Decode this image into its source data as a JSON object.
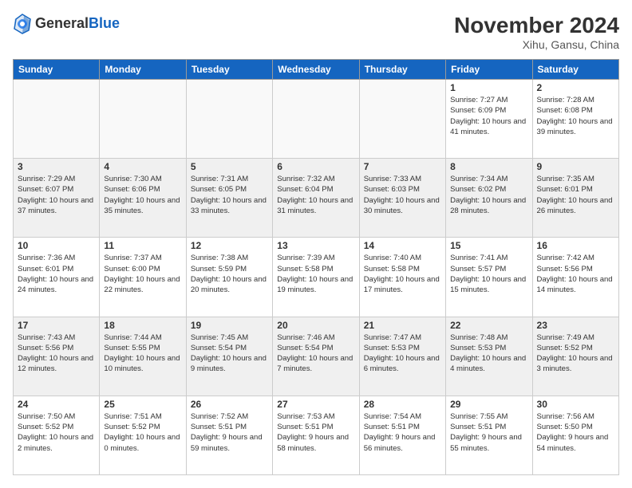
{
  "header": {
    "logo": {
      "general": "General",
      "blue": "Blue"
    },
    "title": "November 2024",
    "location": "Xihu, Gansu, China"
  },
  "days_of_week": [
    "Sunday",
    "Monday",
    "Tuesday",
    "Wednesday",
    "Thursday",
    "Friday",
    "Saturday"
  ],
  "weeks": [
    [
      {
        "day": "",
        "empty": true
      },
      {
        "day": "",
        "empty": true
      },
      {
        "day": "",
        "empty": true
      },
      {
        "day": "",
        "empty": true
      },
      {
        "day": "",
        "empty": true
      },
      {
        "day": "1",
        "sunrise": "Sunrise: 7:27 AM",
        "sunset": "Sunset: 6:09 PM",
        "daylight": "Daylight: 10 hours and 41 minutes."
      },
      {
        "day": "2",
        "sunrise": "Sunrise: 7:28 AM",
        "sunset": "Sunset: 6:08 PM",
        "daylight": "Daylight: 10 hours and 39 minutes."
      }
    ],
    [
      {
        "day": "3",
        "sunrise": "Sunrise: 7:29 AM",
        "sunset": "Sunset: 6:07 PM",
        "daylight": "Daylight: 10 hours and 37 minutes."
      },
      {
        "day": "4",
        "sunrise": "Sunrise: 7:30 AM",
        "sunset": "Sunset: 6:06 PM",
        "daylight": "Daylight: 10 hours and 35 minutes."
      },
      {
        "day": "5",
        "sunrise": "Sunrise: 7:31 AM",
        "sunset": "Sunset: 6:05 PM",
        "daylight": "Daylight: 10 hours and 33 minutes."
      },
      {
        "day": "6",
        "sunrise": "Sunrise: 7:32 AM",
        "sunset": "Sunset: 6:04 PM",
        "daylight": "Daylight: 10 hours and 31 minutes."
      },
      {
        "day": "7",
        "sunrise": "Sunrise: 7:33 AM",
        "sunset": "Sunset: 6:03 PM",
        "daylight": "Daylight: 10 hours and 30 minutes."
      },
      {
        "day": "8",
        "sunrise": "Sunrise: 7:34 AM",
        "sunset": "Sunset: 6:02 PM",
        "daylight": "Daylight: 10 hours and 28 minutes."
      },
      {
        "day": "9",
        "sunrise": "Sunrise: 7:35 AM",
        "sunset": "Sunset: 6:01 PM",
        "daylight": "Daylight: 10 hours and 26 minutes."
      }
    ],
    [
      {
        "day": "10",
        "sunrise": "Sunrise: 7:36 AM",
        "sunset": "Sunset: 6:01 PM",
        "daylight": "Daylight: 10 hours and 24 minutes."
      },
      {
        "day": "11",
        "sunrise": "Sunrise: 7:37 AM",
        "sunset": "Sunset: 6:00 PM",
        "daylight": "Daylight: 10 hours and 22 minutes."
      },
      {
        "day": "12",
        "sunrise": "Sunrise: 7:38 AM",
        "sunset": "Sunset: 5:59 PM",
        "daylight": "Daylight: 10 hours and 20 minutes."
      },
      {
        "day": "13",
        "sunrise": "Sunrise: 7:39 AM",
        "sunset": "Sunset: 5:58 PM",
        "daylight": "Daylight: 10 hours and 19 minutes."
      },
      {
        "day": "14",
        "sunrise": "Sunrise: 7:40 AM",
        "sunset": "Sunset: 5:58 PM",
        "daylight": "Daylight: 10 hours and 17 minutes."
      },
      {
        "day": "15",
        "sunrise": "Sunrise: 7:41 AM",
        "sunset": "Sunset: 5:57 PM",
        "daylight": "Daylight: 10 hours and 15 minutes."
      },
      {
        "day": "16",
        "sunrise": "Sunrise: 7:42 AM",
        "sunset": "Sunset: 5:56 PM",
        "daylight": "Daylight: 10 hours and 14 minutes."
      }
    ],
    [
      {
        "day": "17",
        "sunrise": "Sunrise: 7:43 AM",
        "sunset": "Sunset: 5:56 PM",
        "daylight": "Daylight: 10 hours and 12 minutes."
      },
      {
        "day": "18",
        "sunrise": "Sunrise: 7:44 AM",
        "sunset": "Sunset: 5:55 PM",
        "daylight": "Daylight: 10 hours and 10 minutes."
      },
      {
        "day": "19",
        "sunrise": "Sunrise: 7:45 AM",
        "sunset": "Sunset: 5:54 PM",
        "daylight": "Daylight: 10 hours and 9 minutes."
      },
      {
        "day": "20",
        "sunrise": "Sunrise: 7:46 AM",
        "sunset": "Sunset: 5:54 PM",
        "daylight": "Daylight: 10 hours and 7 minutes."
      },
      {
        "day": "21",
        "sunrise": "Sunrise: 7:47 AM",
        "sunset": "Sunset: 5:53 PM",
        "daylight": "Daylight: 10 hours and 6 minutes."
      },
      {
        "day": "22",
        "sunrise": "Sunrise: 7:48 AM",
        "sunset": "Sunset: 5:53 PM",
        "daylight": "Daylight: 10 hours and 4 minutes."
      },
      {
        "day": "23",
        "sunrise": "Sunrise: 7:49 AM",
        "sunset": "Sunset: 5:52 PM",
        "daylight": "Daylight: 10 hours and 3 minutes."
      }
    ],
    [
      {
        "day": "24",
        "sunrise": "Sunrise: 7:50 AM",
        "sunset": "Sunset: 5:52 PM",
        "daylight": "Daylight: 10 hours and 2 minutes."
      },
      {
        "day": "25",
        "sunrise": "Sunrise: 7:51 AM",
        "sunset": "Sunset: 5:52 PM",
        "daylight": "Daylight: 10 hours and 0 minutes."
      },
      {
        "day": "26",
        "sunrise": "Sunrise: 7:52 AM",
        "sunset": "Sunset: 5:51 PM",
        "daylight": "Daylight: 9 hours and 59 minutes."
      },
      {
        "day": "27",
        "sunrise": "Sunrise: 7:53 AM",
        "sunset": "Sunset: 5:51 PM",
        "daylight": "Daylight: 9 hours and 58 minutes."
      },
      {
        "day": "28",
        "sunrise": "Sunrise: 7:54 AM",
        "sunset": "Sunset: 5:51 PM",
        "daylight": "Daylight: 9 hours and 56 minutes."
      },
      {
        "day": "29",
        "sunrise": "Sunrise: 7:55 AM",
        "sunset": "Sunset: 5:51 PM",
        "daylight": "Daylight: 9 hours and 55 minutes."
      },
      {
        "day": "30",
        "sunrise": "Sunrise: 7:56 AM",
        "sunset": "Sunset: 5:50 PM",
        "daylight": "Daylight: 9 hours and 54 minutes."
      }
    ]
  ]
}
